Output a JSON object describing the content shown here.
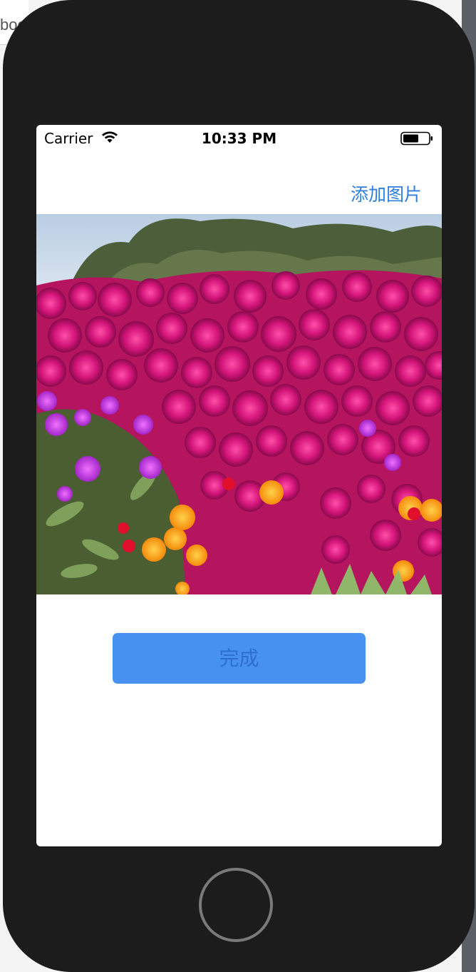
{
  "status_bar": {
    "carrier": "Carrier",
    "time": "10:33 PM",
    "wifi_icon": "wifi-icon",
    "battery_icon": "battery-icon"
  },
  "nav_bar": {
    "add_photo_label": "添加图片"
  },
  "main": {
    "photo_subject": "field of magenta and orange ice plant flowers",
    "done_label": "完成"
  },
  "background": {
    "tab_text": "boo"
  },
  "colors": {
    "accent": "#2f7fe0",
    "button_fill": "#4791f0",
    "button_text": "#2d6fd0",
    "device_frame": "#1c1c1c"
  }
}
